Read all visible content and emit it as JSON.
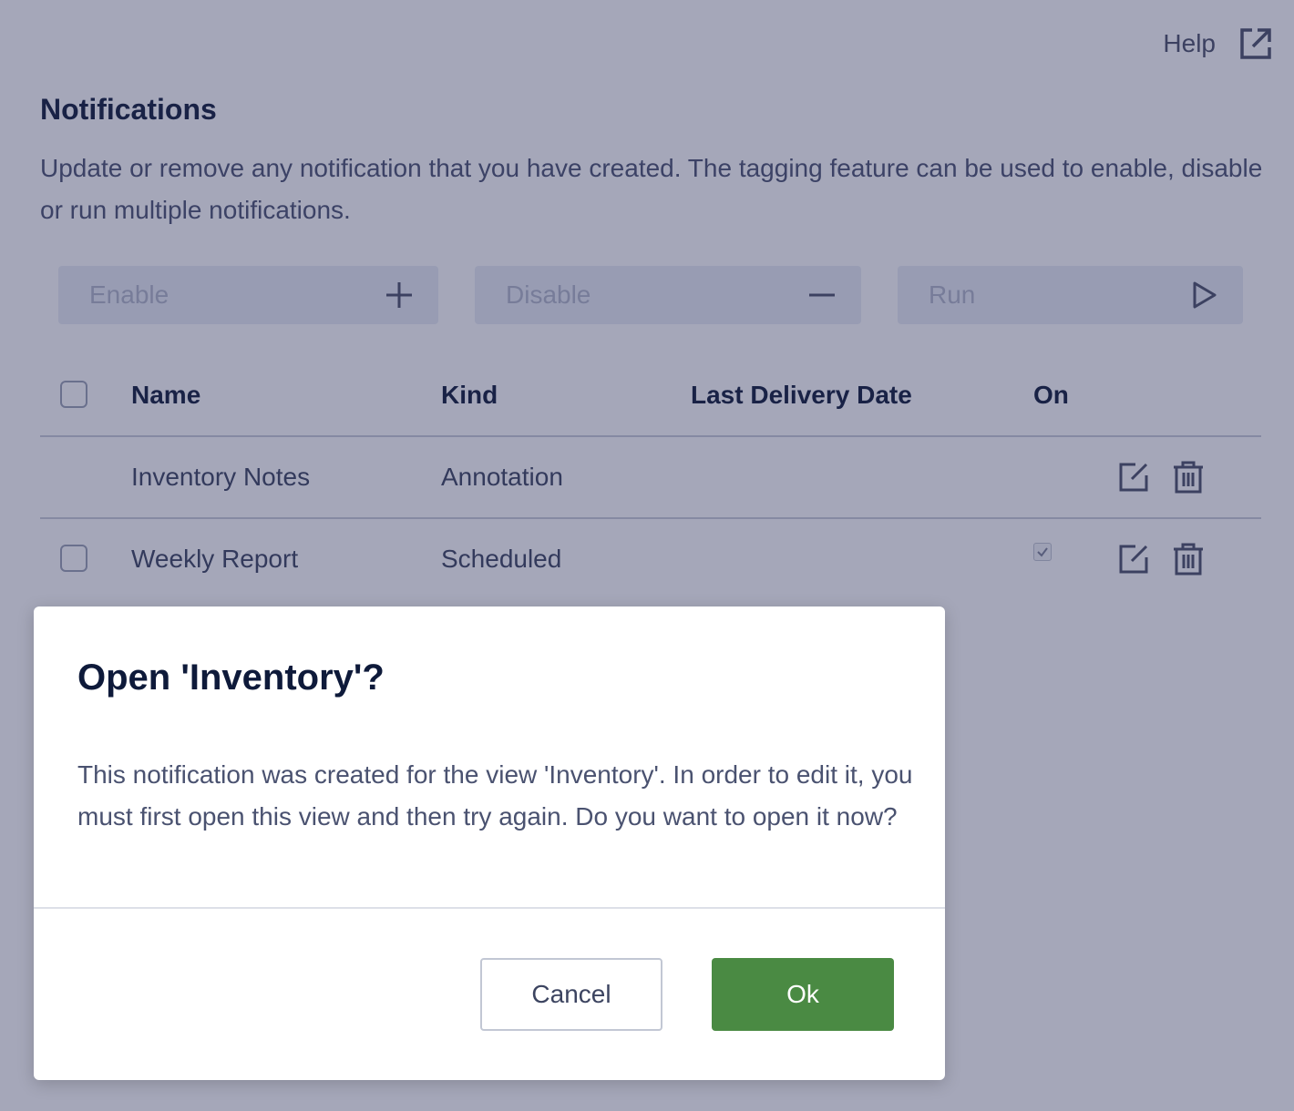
{
  "header": {
    "help_label": "Help",
    "help_icon": "external-link-icon"
  },
  "page": {
    "title": "Notifications",
    "description": "Update or remove any notification that you have created. The tagging feature can be used to enable, disable or run multiple notifications."
  },
  "tag_actions": {
    "enable_placeholder": "Enable",
    "enable_icon": "plus-icon",
    "disable_placeholder": "Disable",
    "disable_icon": "minus-icon",
    "run_placeholder": "Run",
    "run_icon": "play-icon"
  },
  "table": {
    "columns": {
      "name": "Name",
      "kind": "Kind",
      "last_delivery": "Last Delivery Date",
      "on": "On"
    },
    "rows": [
      {
        "name": "Inventory Notes",
        "kind": "Annotation",
        "last_delivery": "",
        "selectable": false,
        "on_toggle_visible": false,
        "on": null
      },
      {
        "name": "Weekly Report",
        "kind": "Scheduled",
        "last_delivery": "",
        "selectable": true,
        "on_toggle_visible": true,
        "on": true
      }
    ],
    "row_actions": [
      "edit-icon",
      "trash-icon"
    ]
  },
  "dialog": {
    "title": "Open 'Inventory'?",
    "body": "This notification was created for the view 'Inventory'. In order to edit it, you must first open this view and then try again. Do you want to open it now?",
    "cancel_label": "Cancel",
    "ok_label": "Ok"
  },
  "colors": {
    "ok_button": "#4a8a43",
    "overlay": "rgba(40, 46, 88, 0.42)",
    "heading": "#0e1a3a"
  }
}
